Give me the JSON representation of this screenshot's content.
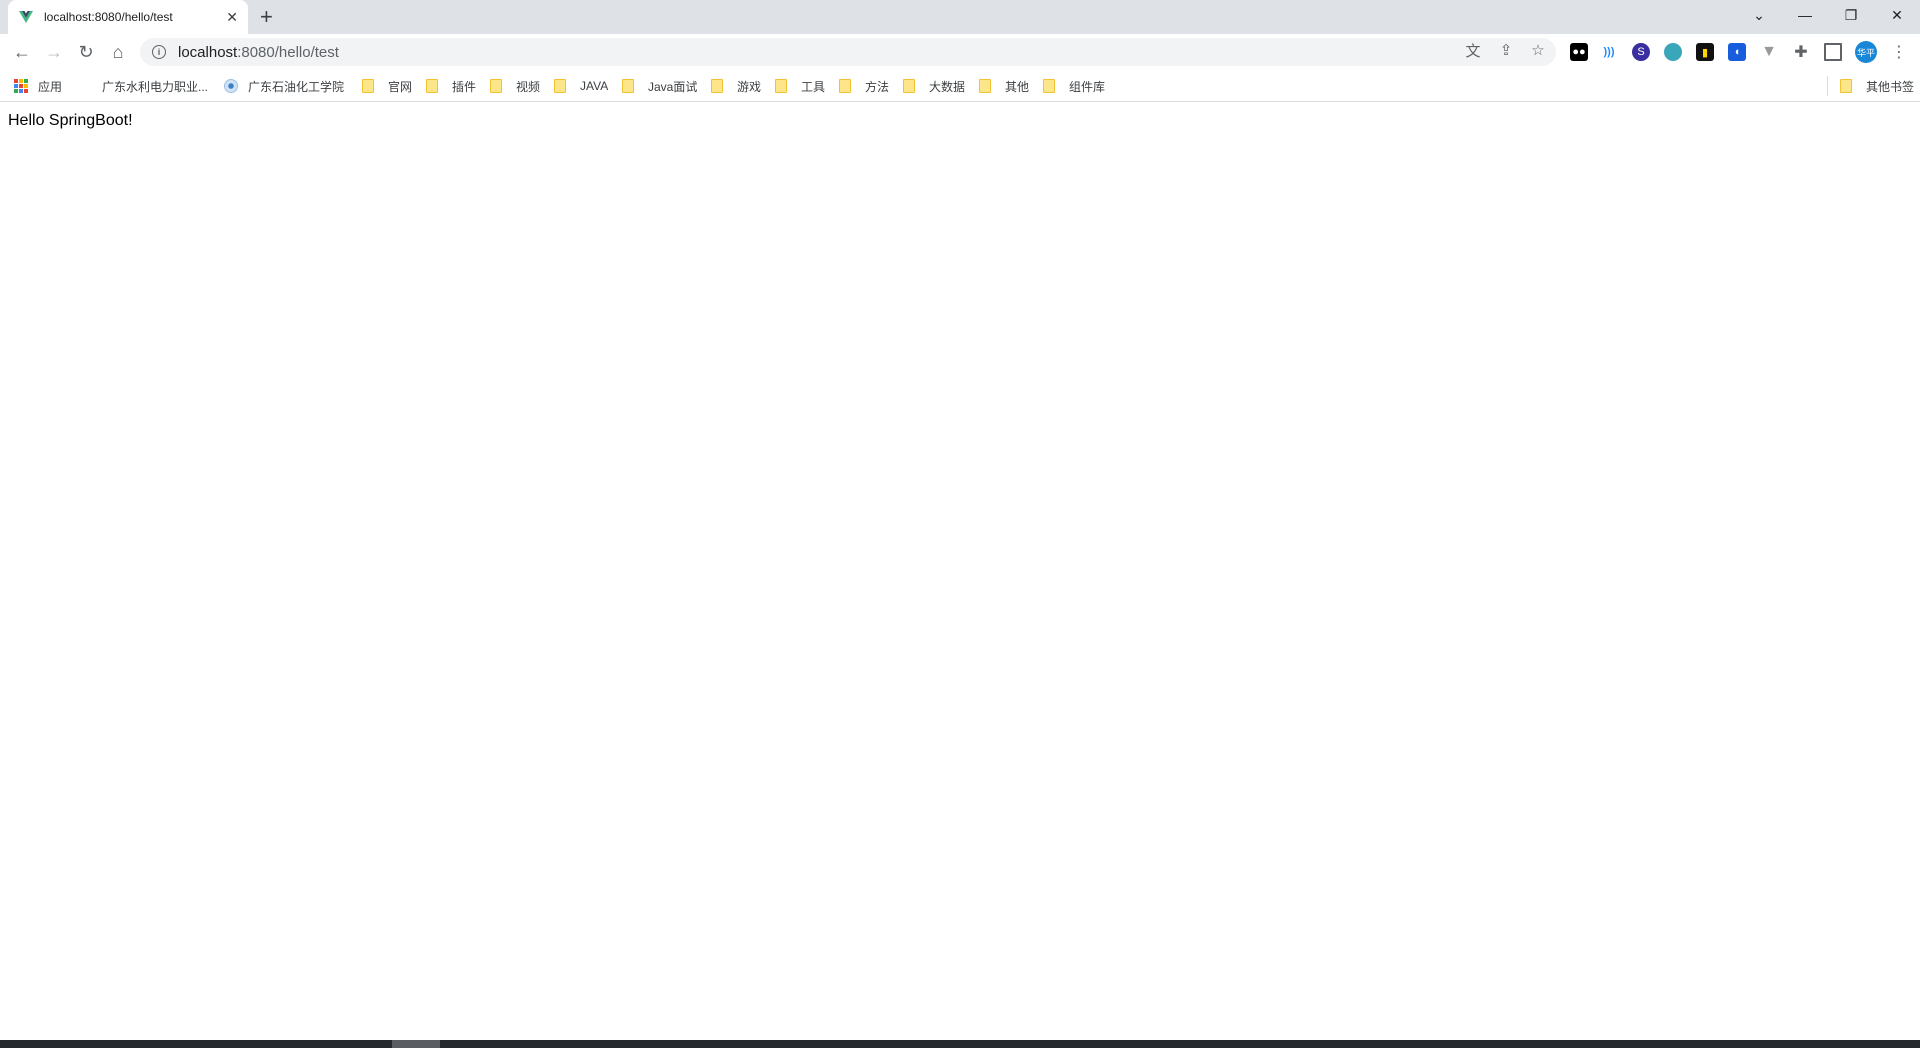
{
  "tab": {
    "title": "localhost:8080/hello/test",
    "favicon": "vue-icon"
  },
  "address": {
    "host": "localhost",
    "path": ":8080/hello/test"
  },
  "bookmarks": [
    {
      "label": "应用",
      "icon": "apps-icon"
    },
    {
      "label": "广东水利电力职业...",
      "icon": "none"
    },
    {
      "label": "广东石油化工学院",
      "icon": "globe-icon"
    },
    {
      "label": "官网",
      "icon": "folder-icon"
    },
    {
      "label": "插件",
      "icon": "folder-icon"
    },
    {
      "label": "视频",
      "icon": "folder-icon"
    },
    {
      "label": "JAVA",
      "icon": "folder-icon"
    },
    {
      "label": "Java面试",
      "icon": "folder-icon"
    },
    {
      "label": "游戏",
      "icon": "folder-icon"
    },
    {
      "label": "工具",
      "icon": "folder-icon"
    },
    {
      "label": "方法",
      "icon": "folder-icon"
    },
    {
      "label": "大数据",
      "icon": "folder-icon"
    },
    {
      "label": "其他",
      "icon": "folder-icon"
    },
    {
      "label": "组件库",
      "icon": "folder-icon"
    }
  ],
  "other_bookmarks": "其他书签",
  "profile": {
    "initials": "华平",
    "color": "#1a87d6"
  },
  "page": {
    "text": "Hello SpringBoot!"
  }
}
